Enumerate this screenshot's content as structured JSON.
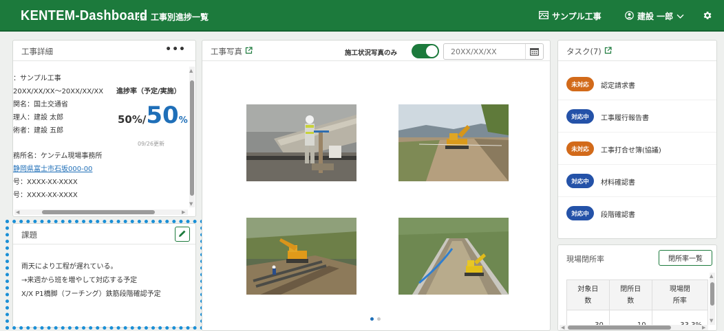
{
  "header": {
    "brand": "KENTEM-Dashboard",
    "nav_label": "工事別進捗一覧",
    "project_label": "サンプル工事",
    "user_label": "建設 一郎"
  },
  "details": {
    "title": "工事詳細",
    "lines": [
      "：サンプル工事",
      "20XX/XX/XX～20XX/XX/XX",
      "関名：国土交通省",
      "理人：建設 太郎",
      "術者：建設 五郎",
      "務所名：ケンテム現場事務所",
      "静岡県富士市石坂000-00",
      "号：XXXX-XX-XXXX",
      "号：XXXX-XX-XXXX"
    ],
    "progress_label": "進捗率（予定/実施）",
    "planned": "50%/",
    "actual": "50",
    "actual_unit": "%",
    "updated": "09/26更新"
  },
  "issues": {
    "title": "課題",
    "lines": [
      "雨天により工程が遅れている。",
      "→来週から班を増やして対応する予定",
      "X/X P1橋脚（フーチング）鉄筋段階確認予定"
    ]
  },
  "photos": {
    "title": "工事写真",
    "toggle_label": "施工状況写真のみ",
    "toggle_on": true,
    "date_placeholder": "20XX/XX/XX"
  },
  "tasks": {
    "title": "タスク(7)",
    "items": [
      {
        "status": "未対応",
        "label": "認定請求書",
        "color": "#d26a1a"
      },
      {
        "status": "対応中",
        "label": "工事履行報告書",
        "color": "#2452a8"
      },
      {
        "status": "未対応",
        "label": "工事打合せ簿(協議)",
        "color": "#d26a1a"
      },
      {
        "status": "対応中",
        "label": "材料確認書",
        "color": "#2452a8"
      },
      {
        "status": "対応中",
        "label": "段階確認書",
        "color": "#2452a8"
      }
    ]
  },
  "closure": {
    "title": "現場閉所率",
    "button": "閉所率一覧",
    "headers": [
      "対象日数",
      "閉所日数",
      "現場閉所率"
    ],
    "headers_split": [
      [
        "対象日",
        "数"
      ],
      [
        "閉所日",
        "数"
      ],
      [
        "現場閉",
        "所率"
      ]
    ],
    "row": [
      "30",
      "10",
      "33.3%"
    ]
  },
  "colors": {
    "brand_green": "#1c7a3c",
    "accent_blue": "#1f6fb8",
    "status_unhandled": "#d26a1a",
    "status_in_progress": "#2452a8"
  }
}
